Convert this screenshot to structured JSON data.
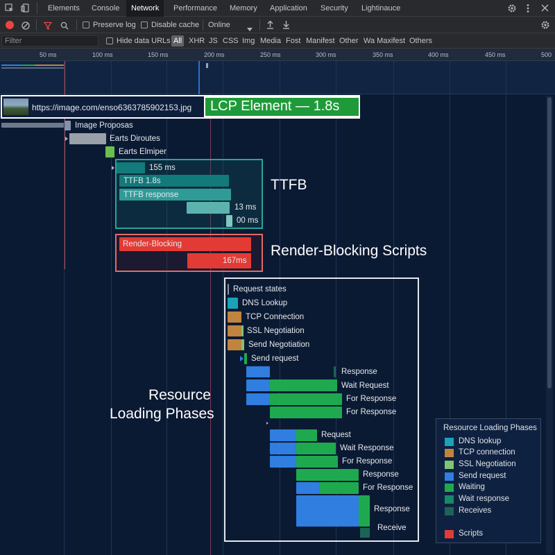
{
  "devtools": {
    "tabs": [
      "Elements",
      "Console",
      "Network",
      "Performance",
      "Memory",
      "Application",
      "Security",
      "Lightinauce"
    ],
    "active_tab": "Network"
  },
  "toolbar": {
    "preserve_log": "Preserve log",
    "disable_cache": "Disable cache",
    "throttle": "Online"
  },
  "filter": {
    "placeholder": "Filter",
    "hide_data_urls": "Hide data URLs",
    "types": [
      "All",
      "XHR",
      "JS",
      "CSS",
      "Img",
      "Media",
      "Fost",
      "Manifest",
      "Other",
      "Wa Maxifest",
      "Others"
    ]
  },
  "timeline": {
    "ticks": [
      "50 ms",
      "100 ms",
      "150 ms",
      "200 ms",
      "250 ms",
      "300 ms",
      "350 ms",
      "400 ms",
      "450 ms",
      "500"
    ]
  },
  "lcp": {
    "url": "https://image.com/enso6363785902153.jpg",
    "label": "LCP Element — 1.8s"
  },
  "requests": [
    "Image Proposas",
    "Earts Diroutes",
    "Earts Elmiper"
  ],
  "ttfb": {
    "title": "TTFB",
    "rows": [
      "155 ms",
      "TTFB 1.8s",
      "TTFB response",
      "13 ms",
      "00 ms"
    ]
  },
  "render_blocking": {
    "title": "Render-Blocking Scripts",
    "rows": [
      "Render-Blocking",
      "167ms"
    ]
  },
  "resource_phases": {
    "title_line1": "Resource",
    "title_line2": "Loading Phases",
    "rows": [
      "Request states",
      "DNS Lookup",
      "TCP Connection",
      "SSL Negotiation",
      "Send Negotiation",
      "Send request",
      "Response",
      "Wait Request",
      "For Response",
      "For Response",
      "Request",
      "Wait Response",
      "For Response",
      "Response",
      "For Response",
      "Response",
      "Receive"
    ]
  },
  "legend": {
    "title": "Resource Loading Phases",
    "items": [
      {
        "label": "DNS lookup",
        "color": "#1aa2b8"
      },
      {
        "label": "TCP connection",
        "color": "#c1843f"
      },
      {
        "label": "SSL Negotiation",
        "color": "#7fc470"
      },
      {
        "label": "Send request",
        "color": "#2f7ee0"
      },
      {
        "label": "Waiting",
        "color": "#1ea94f"
      },
      {
        "label": "Wait response",
        "color": "#178a66"
      },
      {
        "label": "Receives",
        "color": "#1e6456"
      },
      {
        "label": "Scripts",
        "color": "#e23b35"
      }
    ]
  }
}
